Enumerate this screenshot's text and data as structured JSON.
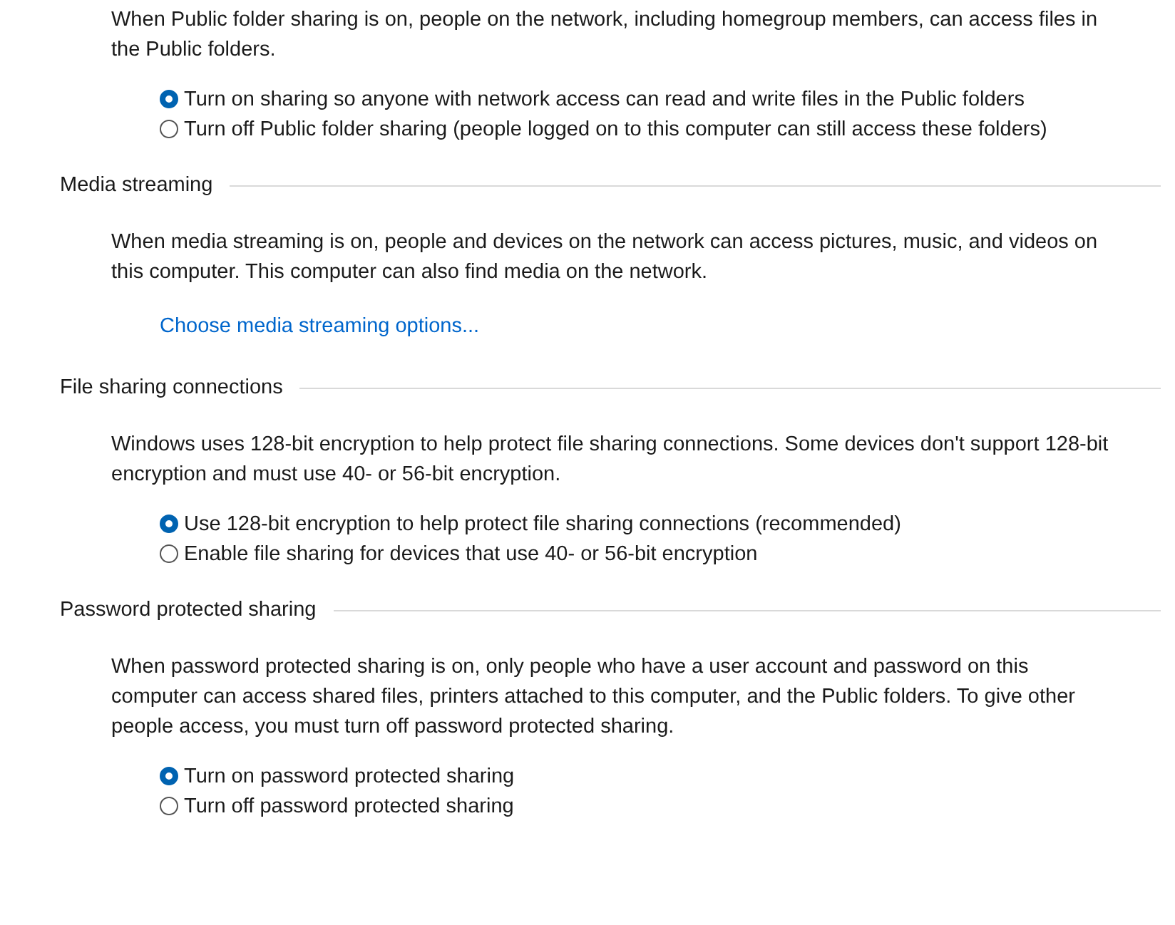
{
  "intro": {
    "description": "When Public folder sharing is on, people on the network, including homegroup members, can access files in the Public folders.",
    "options": [
      {
        "label": "Turn on sharing so anyone with network access can read and write files in the Public folders",
        "selected": true
      },
      {
        "label": "Turn off Public folder sharing (people logged on to this computer can still access these folders)",
        "selected": false
      }
    ]
  },
  "sections": [
    {
      "title": "Media streaming",
      "description": "When media streaming is on, people and devices on the network can access pictures, music, and videos on this computer. This computer can also find media on the network.",
      "link": "Choose media streaming options..."
    },
    {
      "title": "File sharing connections",
      "description": "Windows uses 128-bit encryption to help protect file sharing connections. Some devices don't support 128-bit encryption and must use 40- or 56-bit encryption.",
      "options": [
        {
          "label": "Use 128-bit encryption to help protect file sharing connections (recommended)",
          "selected": true
        },
        {
          "label": "Enable file sharing for devices that use 40- or 56-bit encryption",
          "selected": false
        }
      ]
    },
    {
      "title": "Password protected sharing",
      "description": "When password protected sharing is on, only people who have a user account and password on this computer can access shared files, printers attached to this computer, and the Public folders. To give other people access, you must turn off password protected sharing.",
      "options": [
        {
          "label": "Turn on password protected sharing",
          "selected": true
        },
        {
          "label": "Turn off password protected sharing",
          "selected": false
        }
      ]
    }
  ]
}
